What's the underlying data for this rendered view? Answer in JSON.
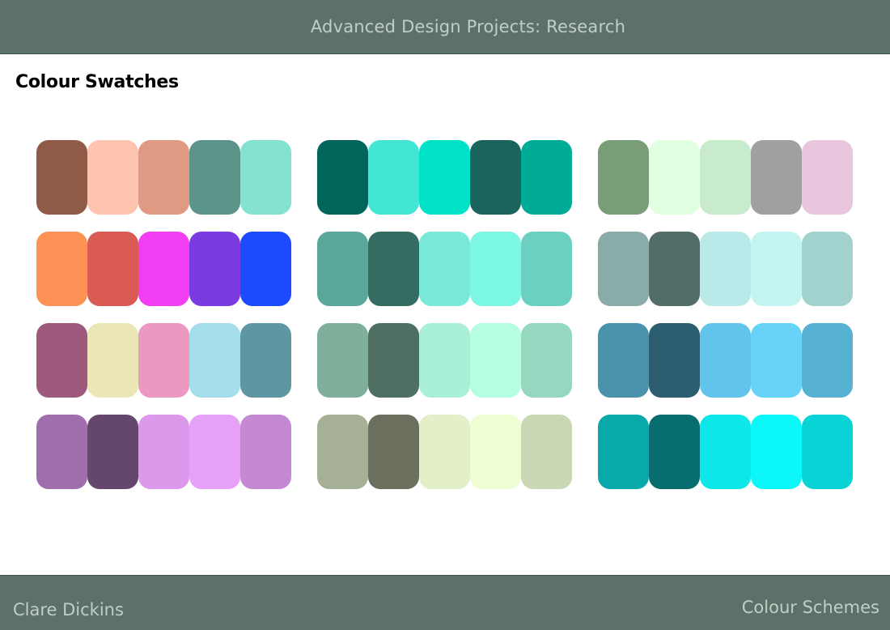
{
  "header": {
    "title": "Advanced Design Projects: Research"
  },
  "page": {
    "title": "Colour Swatches"
  },
  "footer": {
    "author": "Clare Dickins",
    "section": "Colour Schemes"
  },
  "palettes": [
    [
      "#8f5b47",
      "#fec4b0",
      "#e09a83",
      "#5c948a",
      "#84e2d0"
    ],
    [
      "#00655a",
      "#43e5d5",
      "#00e2c8",
      "#1b645e",
      "#00ab98"
    ],
    [
      "#799e77",
      "#e1ffe1",
      "#c8ebcd",
      "#a0a0a0",
      "#e9c6dd"
    ],
    [
      "#fe9256",
      "#d95b53",
      "#f23ef2",
      "#7b3be0",
      "#1b4bfd"
    ],
    [
      "#5aa89b",
      "#356c62",
      "#79eada",
      "#7cf7e3",
      "#6bd0c2"
    ],
    [
      "#89aca9",
      "#526c69",
      "#bae9e9",
      "#c2f5f1",
      "#a1d2cd"
    ],
    [
      "#9e5a7d",
      "#eae6b5",
      "#eb99c0",
      "#a5deeb",
      "#5e97a1"
    ],
    [
      "#7eaf9b",
      "#4f6f63",
      "#aaf0d6",
      "#b5fee1",
      "#96d7bf"
    ],
    [
      "#4b93ad",
      "#2d5e6f",
      "#62c4ec",
      "#68d3f8",
      "#56b1d3"
    ],
    [
      "#a06dad",
      "#65476e",
      "#dc99eb",
      "#e6a0f8",
      "#c588d2"
    ],
    [
      "#a6b095",
      "#6a705d",
      "#e2efc8",
      "#eefdd2",
      "#cad7b5"
    ],
    [
      "#08a8ab",
      "#076d6e",
      "#0de7ea",
      "#0bf7fa",
      "#0ad3d5"
    ]
  ]
}
